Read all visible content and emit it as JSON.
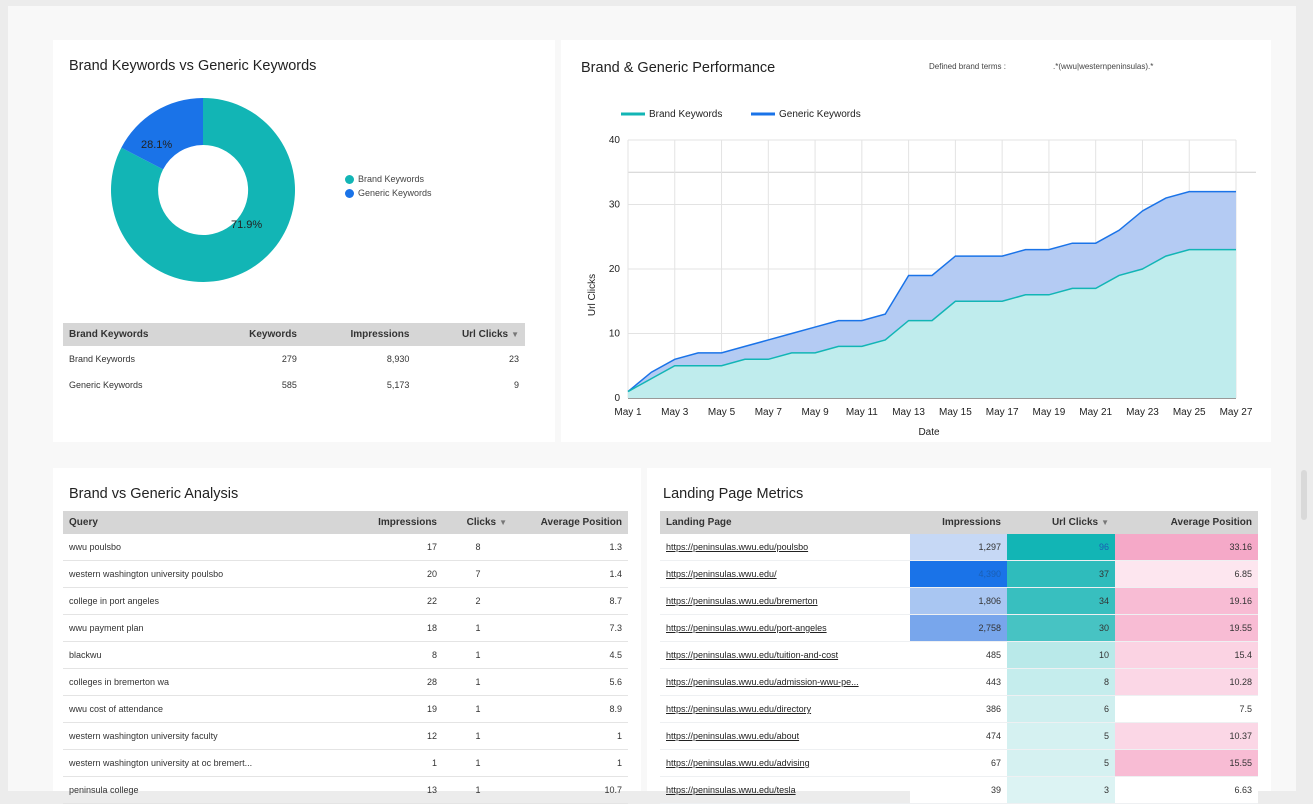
{
  "colors": {
    "brand": "#12b5b5",
    "generic": "#1a73e8",
    "brand_area": "#bfeced",
    "generic_area": "#b4cbf3",
    "pink": "#fbc9dd",
    "header": "#d6d6d6"
  },
  "donut": {
    "title": "Brand Keywords vs Generic Keywords",
    "generic_label": "28.1%",
    "brand_label": "71.9%",
    "legend": [
      "Brand Keywords",
      "Generic Keywords"
    ]
  },
  "brand_table": {
    "headers": [
      "Brand Keywords",
      "Keywords",
      "Impressions",
      "Url Clicks"
    ],
    "rows": [
      {
        "name": "Brand Keywords",
        "keywords": "279",
        "impressions": "8,930",
        "clicks": "23"
      },
      {
        "name": "Generic Keywords",
        "keywords": "585",
        "impressions": "5,173",
        "clicks": "9"
      }
    ]
  },
  "performance": {
    "title": "Brand & Generic Performance",
    "defined_label": "Defined brand terms :",
    "defined_value": ".*(wwu|westernpeninsulas).*",
    "legend": [
      "Brand Keywords",
      "Generic Keywords"
    ],
    "y_label": "Url Clicks",
    "x_label": "Date"
  },
  "chart_data": {
    "type": "area",
    "stacked": true,
    "x": [
      "May 1",
      "May 2",
      "May 3",
      "May 4",
      "May 5",
      "May 6",
      "May 7",
      "May 8",
      "May 9",
      "May 10",
      "May 11",
      "May 12",
      "May 13",
      "May 14",
      "May 15",
      "May 16",
      "May 17",
      "May 18",
      "May 19",
      "May 20",
      "May 21",
      "May 22",
      "May 23",
      "May 24",
      "May 25",
      "May 26",
      "May 27"
    ],
    "x_ticks": [
      "May 1",
      "May 3",
      "May 5",
      "May 7",
      "May 9",
      "May 11",
      "May 13",
      "May 15",
      "May 17",
      "May 19",
      "May 21",
      "May 23",
      "May 25",
      "May 27"
    ],
    "series": [
      {
        "name": "Brand Keywords",
        "values": [
          1,
          3,
          5,
          5,
          5,
          6,
          6,
          7,
          7,
          8,
          8,
          9,
          12,
          12,
          15,
          15,
          15,
          16,
          16,
          17,
          17,
          19,
          20,
          22,
          23,
          23,
          23
        ]
      },
      {
        "name": "Generic Keywords",
        "values": [
          0,
          1,
          1,
          2,
          2,
          2,
          3,
          3,
          4,
          4,
          4,
          4,
          7,
          7,
          7,
          7,
          7,
          7,
          7,
          7,
          7,
          7,
          9,
          9,
          9,
          9,
          9
        ]
      }
    ],
    "ylim": [
      0,
      40
    ],
    "y_ticks": [
      "0",
      "10",
      "20",
      "30",
      "40"
    ],
    "xlabel": "Date",
    "ylabel": "Url Clicks",
    "grid": true,
    "legend": "top-left"
  },
  "analysis": {
    "title": "Brand vs Generic Analysis",
    "headers": [
      "Query",
      "Impressions",
      "Clicks",
      "Average Position"
    ],
    "rows": [
      {
        "q": "wwu poulsbo",
        "imp": "17",
        "clicks": "8",
        "pos": "1.3"
      },
      {
        "q": "western washington university poulsbo",
        "imp": "20",
        "clicks": "7",
        "pos": "1.4"
      },
      {
        "q": "college in port angeles",
        "imp": "22",
        "clicks": "2",
        "pos": "8.7"
      },
      {
        "q": "wwu payment plan",
        "imp": "18",
        "clicks": "1",
        "pos": "7.3"
      },
      {
        "q": "blackwu",
        "imp": "8",
        "clicks": "1",
        "pos": "4.5"
      },
      {
        "q": "colleges in bremerton wa",
        "imp": "28",
        "clicks": "1",
        "pos": "5.6"
      },
      {
        "q": "wwu cost of attendance",
        "imp": "19",
        "clicks": "1",
        "pos": "8.9"
      },
      {
        "q": "western washington university faculty",
        "imp": "12",
        "clicks": "1",
        "pos": "1"
      },
      {
        "q": "western washington university at oc bremert...",
        "imp": "1",
        "clicks": "1",
        "pos": "1"
      },
      {
        "q": "peninsula college",
        "imp": "13",
        "clicks": "1",
        "pos": "10.7"
      }
    ]
  },
  "landing": {
    "title": "Landing Page Metrics",
    "headers": [
      "Landing Page",
      "Impressions",
      "Url Clicks",
      "Average Position"
    ],
    "rows": [
      {
        "page": "https://peninsulas.wwu.edu/poulsbo",
        "imp": "1,297",
        "clicks": "96",
        "pos": "33.16",
        "imp_bg": "#c6d8f5",
        "clk_bg": "#12b5b5",
        "pos_bg": "#f5a9c8"
      },
      {
        "page": "https://peninsulas.wwu.edu/",
        "imp": "4,390",
        "clicks": "37",
        "pos": "6.85",
        "imp_bg": "#1a73e8",
        "clk_bg": "#2fbcbc",
        "pos_bg": "#fde6ef"
      },
      {
        "page": "https://peninsulas.wwu.edu/bremerton",
        "imp": "1,806",
        "clicks": "34",
        "pos": "19.16",
        "imp_bg": "#a9c6f2",
        "clk_bg": "#38bfbf",
        "pos_bg": "#f8bcd4"
      },
      {
        "page": "https://peninsulas.wwu.edu/port-angeles",
        "imp": "2,758",
        "clicks": "30",
        "pos": "19.55",
        "imp_bg": "#78a6ec",
        "clk_bg": "#47c3c3",
        "pos_bg": "#f8bcd4"
      },
      {
        "page": "https://peninsulas.wwu.edu/tuition-and-cost",
        "imp": "485",
        "clicks": "10",
        "pos": "15.4",
        "imp_bg": "#ffffff",
        "clk_bg": "#b9e9e9",
        "pos_bg": "#fbd3e3"
      },
      {
        "page": "https://peninsulas.wwu.edu/admission-wwu-pe...",
        "imp": "443",
        "clicks": "8",
        "pos": "10.28",
        "imp_bg": "#ffffff",
        "clk_bg": "#c5eded",
        "pos_bg": "#fbd7e6"
      },
      {
        "page": "https://peninsulas.wwu.edu/directory",
        "imp": "386",
        "clicks": "6",
        "pos": "7.5",
        "imp_bg": "#ffffff",
        "clk_bg": "#cfefef",
        "pos_bg": "#ffffff"
      },
      {
        "page": "https://peninsulas.wwu.edu/about",
        "imp": "474",
        "clicks": "5",
        "pos": "10.37",
        "imp_bg": "#ffffff",
        "clk_bg": "#d5f1f1",
        "pos_bg": "#fbd7e6"
      },
      {
        "page": "https://peninsulas.wwu.edu/advising",
        "imp": "67",
        "clicks": "5",
        "pos": "15.55",
        "imp_bg": "#ffffff",
        "clk_bg": "#d5f1f1",
        "pos_bg": "#f8bcd4"
      },
      {
        "page": "https://peninsulas.wwu.edu/tesla",
        "imp": "39",
        "clicks": "3",
        "pos": "6.63",
        "imp_bg": "#ffffff",
        "clk_bg": "#dcf3f3",
        "pos_bg": "#ffffff"
      }
    ]
  }
}
